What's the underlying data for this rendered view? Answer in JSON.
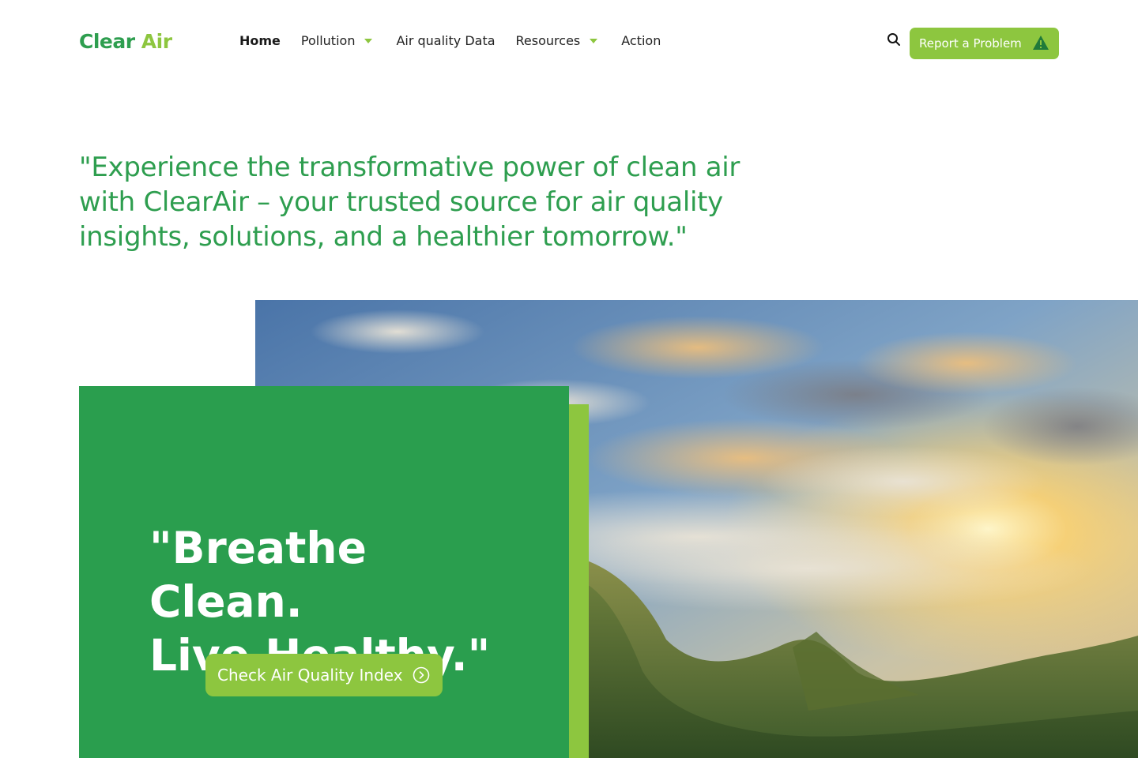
{
  "brand": {
    "part1": "Clear",
    "part2": "Air"
  },
  "nav": {
    "items": [
      {
        "label": "Home",
        "active": true,
        "dropdown": false
      },
      {
        "label": "Pollution",
        "active": false,
        "dropdown": true
      },
      {
        "label": "Air quality Data",
        "active": false,
        "dropdown": false
      },
      {
        "label": "Resources",
        "active": false,
        "dropdown": true
      },
      {
        "label": "Action",
        "active": false,
        "dropdown": false
      }
    ],
    "search_icon": "search-icon",
    "report_button": {
      "label": "Report a Problem",
      "icon": "warning-icon"
    }
  },
  "tagline": "\"Experience the transformative power of clean air with ClearAir – your trusted source for air quality insights, solutions, and a healthier tomorrow.\"",
  "hero": {
    "heading_line1": "\"Breathe Clean.",
    "heading_line2": "Live Healthy.\"",
    "cta_label": "Check Air Quality Index",
    "cta_icon": "chevron-right-circle-icon",
    "image": "mountain-landscape-sunrise"
  },
  "colors": {
    "primary_green": "#2a9e4e",
    "accent_lime": "#8dc63f",
    "text_dark": "#222222"
  }
}
